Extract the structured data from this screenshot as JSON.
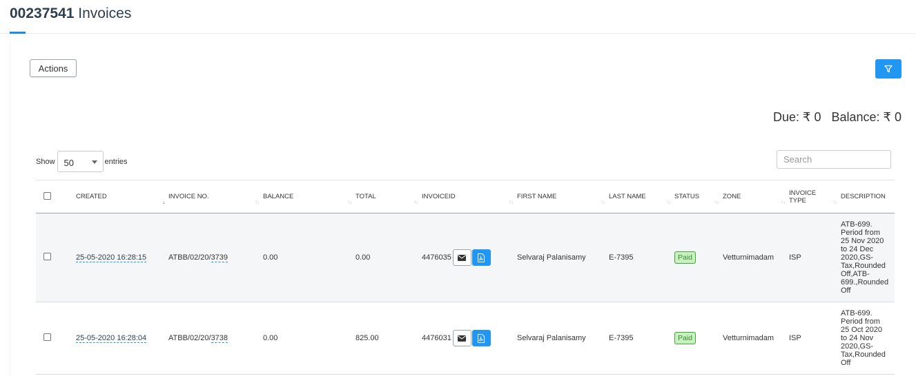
{
  "header": {
    "title_number": "00237541",
    "title_text": "Invoices"
  },
  "toolbar": {
    "actions_label": "Actions",
    "filter_icon": "filter-icon"
  },
  "totals": {
    "due": "Due: ₹ 0",
    "balance": "Balance: ₹ 0"
  },
  "length": {
    "show_label": "Show",
    "selected": "50",
    "entries_label": "entries"
  },
  "search": {
    "placeholder": "Search"
  },
  "table": {
    "columns": [
      "CREATED",
      "INVOICE NO.",
      "BALANCE",
      "TOTAL",
      "INVOICEID",
      "FIRST NAME",
      "LAST NAME",
      "STATUS",
      "ZONE",
      "INVOICE TYPE",
      "DESCRIPTION"
    ],
    "rows": [
      {
        "created": "25-05-2020 16:28:15",
        "invoice_prefix": "ATBB/02/20/",
        "invoice_suffix": "3739",
        "balance": "0.00",
        "total": "0.00",
        "invoice_id": "4476035",
        "first_name": "Selvaraj Palanisamy",
        "last_name": "E-7395",
        "status": "Paid",
        "zone": "Vetturnimadam",
        "invoice_type": "ISP",
        "description": "ATB-699. Period from 25 Nov 2020 to 24 Dec 2020,GS-Tax,Rounded Off,ATB-699.,Rounded Off"
      },
      {
        "created": "25-05-2020 16:28:04",
        "invoice_prefix": "ATBB/02/20/",
        "invoice_suffix": "3738",
        "balance": "0.00",
        "total": "825.00",
        "invoice_id": "4476031",
        "first_name": "Selvaraj Palanisamy",
        "last_name": "E-7395",
        "status": "Paid",
        "zone": "Vetturnimadam",
        "invoice_type": "ISP",
        "description": "ATB-699. Period from 25 Oct 2020 to 24 Nov 2020,GS-Tax,Rounded Off"
      }
    ]
  },
  "colors": {
    "accent": "#2196f3",
    "paid_bg": "#c8f0c0",
    "paid_text": "#3a8a2e"
  }
}
